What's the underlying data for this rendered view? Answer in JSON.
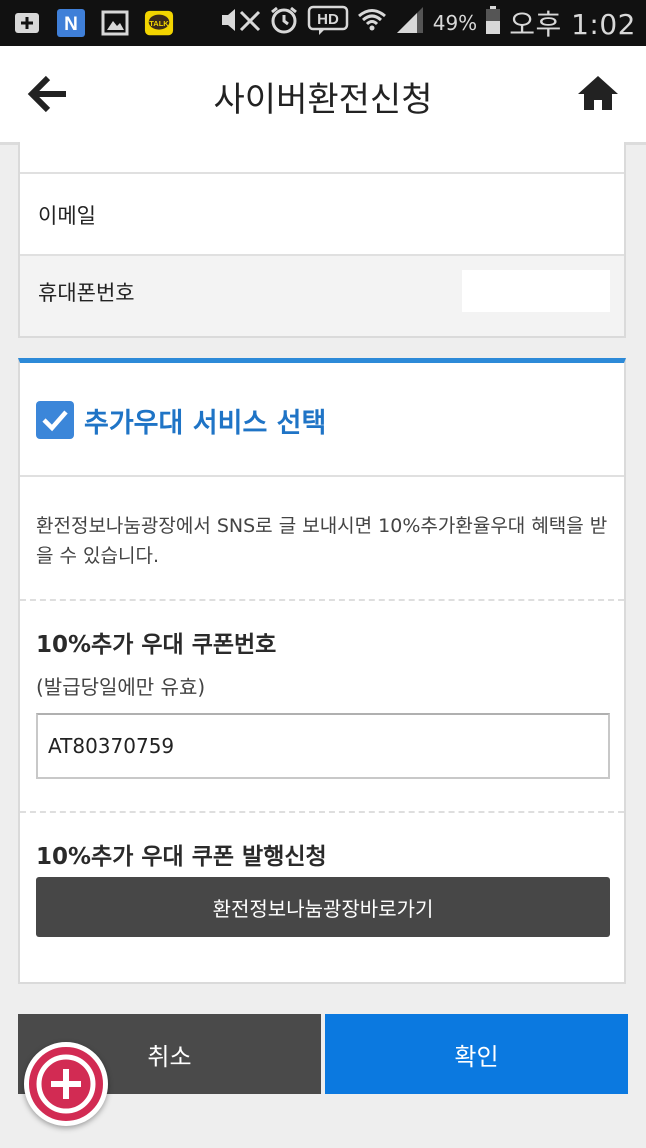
{
  "status_bar": {
    "battery_percent": "49%",
    "time": "오후 1:02",
    "icons": [
      "add-box-icon",
      "naver-icon",
      "gallery-icon",
      "kakaotalk-icon",
      "mute-icon",
      "alarm-icon",
      "hd-icon",
      "wifi-icon",
      "signal-icon",
      "battery-icon"
    ],
    "kakao_label": "TALK",
    "naver_label": "N",
    "hd_label": "HD"
  },
  "header": {
    "title": "사이버환전신청",
    "back_icon": "arrow-left-icon",
    "home_icon": "home-icon"
  },
  "contact": {
    "email_label": "이메일",
    "phone_label": "휴대폰번호"
  },
  "option": {
    "checked": true,
    "title": "추가우대 서비스 선택",
    "description": "환전정보나눔광장에서 SNS로 글 보내시면 10%추가환율우대 혜택을 받을 수 있습니다.",
    "coupon_title": "10%추가 우대 쿠폰번호",
    "coupon_note": "(발급당일에만 유효)",
    "coupon_value": "AT80370759",
    "issue_title": "10%추가 우대 쿠폰 발행신청",
    "issue_button": "환전정보나눔광장바로가기"
  },
  "actions": {
    "cancel": "취소",
    "confirm": "확인"
  },
  "colors": {
    "accent_blue": "#0b79e0",
    "header_blue_text": "#1f74c6",
    "fab_red": "#d22b53",
    "dark_button": "#474747"
  }
}
